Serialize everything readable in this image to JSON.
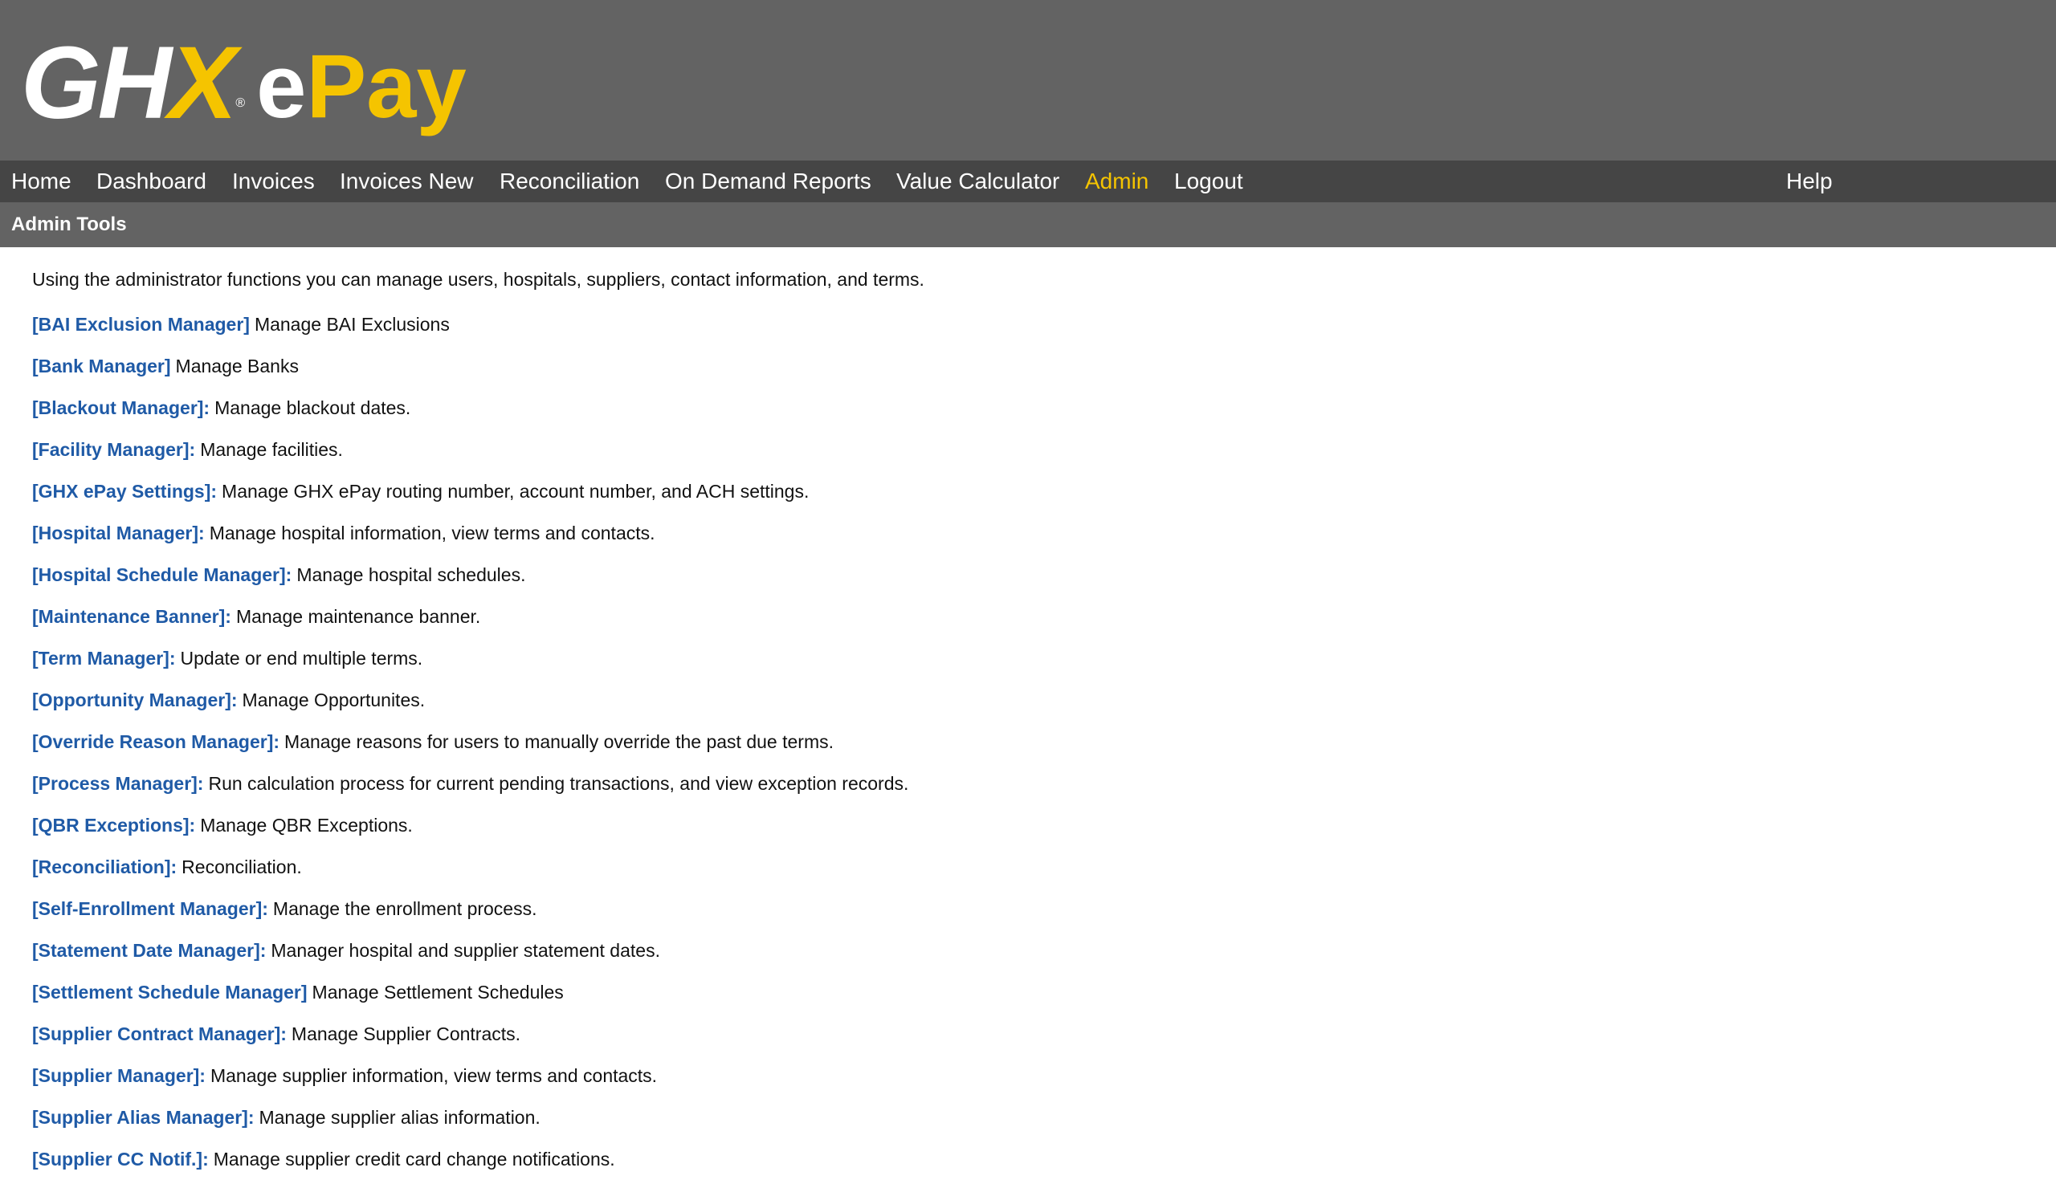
{
  "logo": {
    "ghx_main": "GH",
    "ghx_x": "X",
    "registered": "®",
    "e": "e",
    "pay": "Pay"
  },
  "nav": [
    {
      "label": "Home",
      "active": false
    },
    {
      "label": "Dashboard",
      "active": false
    },
    {
      "label": "Invoices",
      "active": false
    },
    {
      "label": "Invoices New",
      "active": false
    },
    {
      "label": "Reconciliation",
      "active": false
    },
    {
      "label": "On Demand Reports",
      "active": false
    },
    {
      "label": "Value Calculator",
      "active": false
    },
    {
      "label": "Admin",
      "active": true
    },
    {
      "label": "Logout",
      "active": false
    }
  ],
  "help_label": "Help",
  "subbar_title": "Admin Tools",
  "intro": "Using the administrator functions you can manage users, hospitals, suppliers, contact information, and terms.",
  "tools": [
    {
      "link": "[BAI Exclusion Manager]",
      "desc": "Manage BAI Exclusions"
    },
    {
      "link": "[Bank Manager]",
      "desc": "Manage Banks"
    },
    {
      "link": "[Blackout Manager]:",
      "desc": "Manage blackout dates."
    },
    {
      "link": "[Facility Manager]:",
      "desc": "Manage facilities."
    },
    {
      "link": "[GHX ePay Settings]:",
      "desc": "Manage GHX ePay routing number, account number, and ACH settings."
    },
    {
      "link": "[Hospital Manager]:",
      "desc": "Manage hospital information, view terms and contacts."
    },
    {
      "link": "[Hospital Schedule Manager]:",
      "desc": "Manage hospital schedules."
    },
    {
      "link": "[Maintenance Banner]:",
      "desc": "Manage maintenance banner."
    },
    {
      "link": "[Term Manager]:",
      "desc": "Update or end multiple terms."
    },
    {
      "link": "[Opportunity Manager]:",
      "desc": "Manage Opportunites."
    },
    {
      "link": "[Override Reason Manager]:",
      "desc": "Manage reasons for users to manually override the past due terms."
    },
    {
      "link": "[Process Manager]:",
      "desc": "Run calculation process for current pending transactions, and view exception records."
    },
    {
      "link": "[QBR Exceptions]:",
      "desc": "Manage QBR Exceptions."
    },
    {
      "link": "[Reconciliation]:",
      "desc": "Reconciliation."
    },
    {
      "link": "[Self-Enrollment Manager]:",
      "desc": "Manage the enrollment process."
    },
    {
      "link": "[Statement Date Manager]:",
      "desc": "Manager hospital and supplier statement dates."
    },
    {
      "link": "[Settlement Schedule Manager]",
      "desc": "Manage Settlement Schedules"
    },
    {
      "link": "[Supplier Contract Manager]:",
      "desc": "Manage Supplier Contracts."
    },
    {
      "link": "[Supplier Manager]:",
      "desc": "Manage supplier information, view terms and contacts."
    },
    {
      "link": "[Supplier Alias Manager]:",
      "desc": "Manage supplier alias information."
    },
    {
      "link": "[Supplier CC Notif.]:",
      "desc": "Manage supplier credit card change notifications."
    }
  ],
  "colors": {
    "header_bg": "#636363",
    "nav_bg": "#454545",
    "accent_yellow": "#f5c400",
    "link_blue": "#1f5aa6"
  }
}
